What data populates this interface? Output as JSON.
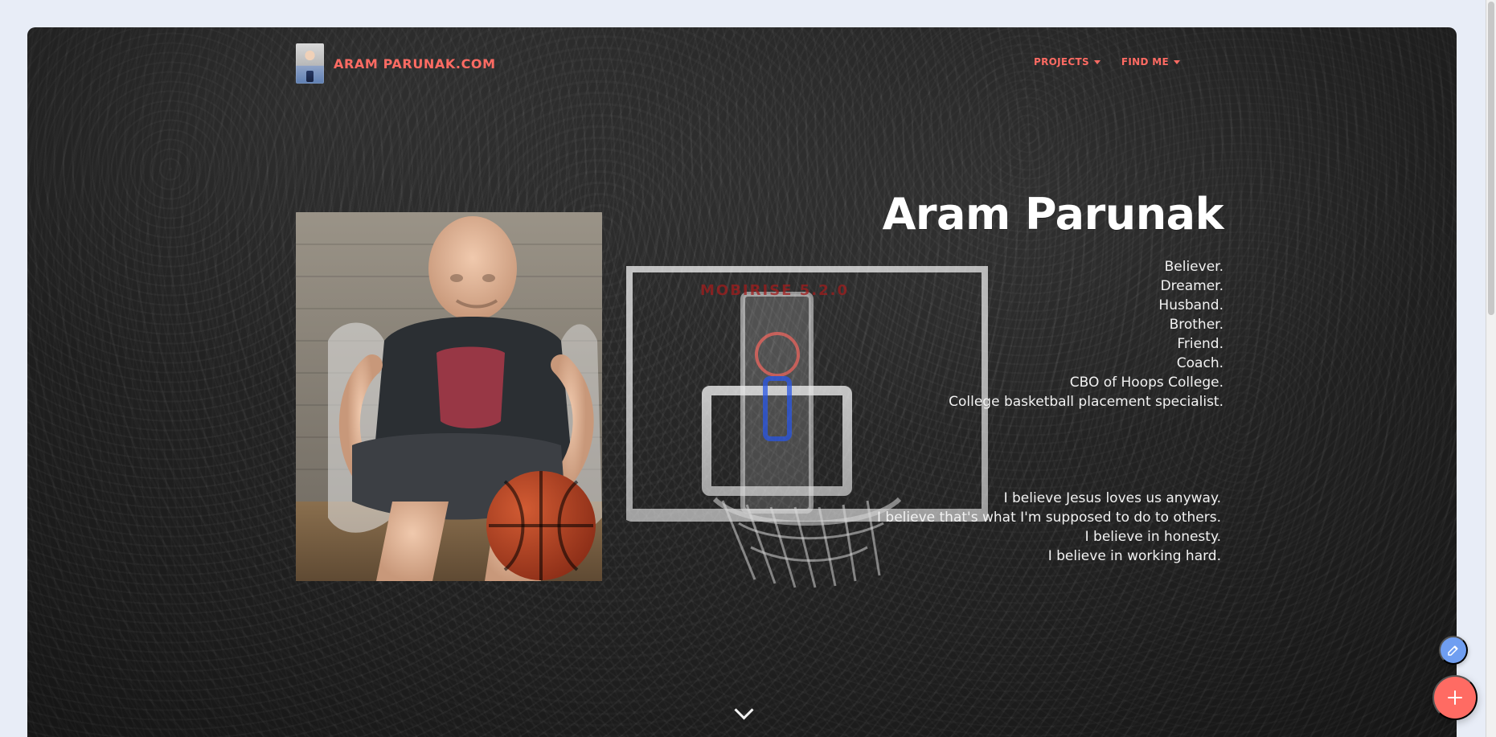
{
  "site": {
    "brand": "ARAM PARUNAK.COM"
  },
  "nav": {
    "items": [
      {
        "label": "PROJECTS"
      },
      {
        "label": "FIND ME"
      }
    ]
  },
  "hero": {
    "title": "Aram Parunak",
    "identity": [
      "Believer.",
      "Dreamer.",
      "Husband.",
      "Brother.",
      "Friend.",
      "Coach.",
      "CBO of Hoops College.",
      "College basketball placement specialist."
    ],
    "beliefs": [
      "I believe Jesus loves us anyway.",
      "I believe that's what I'm supposed to do to others.",
      "I believe in honesty.",
      "I believe in working hard."
    ],
    "watermark_text": "MOBIRISE 5.2.0"
  },
  "ui": {
    "icons": {
      "logo": "avatar-icon",
      "caret": "caret-down-icon",
      "scroll_down": "chevron-down-icon",
      "edit": "pencil-icon",
      "add": "plus-icon"
    },
    "colors": {
      "accent": "#ff6b63",
      "edit_fab": "#6f9ef1",
      "text": "#ffffff"
    }
  }
}
